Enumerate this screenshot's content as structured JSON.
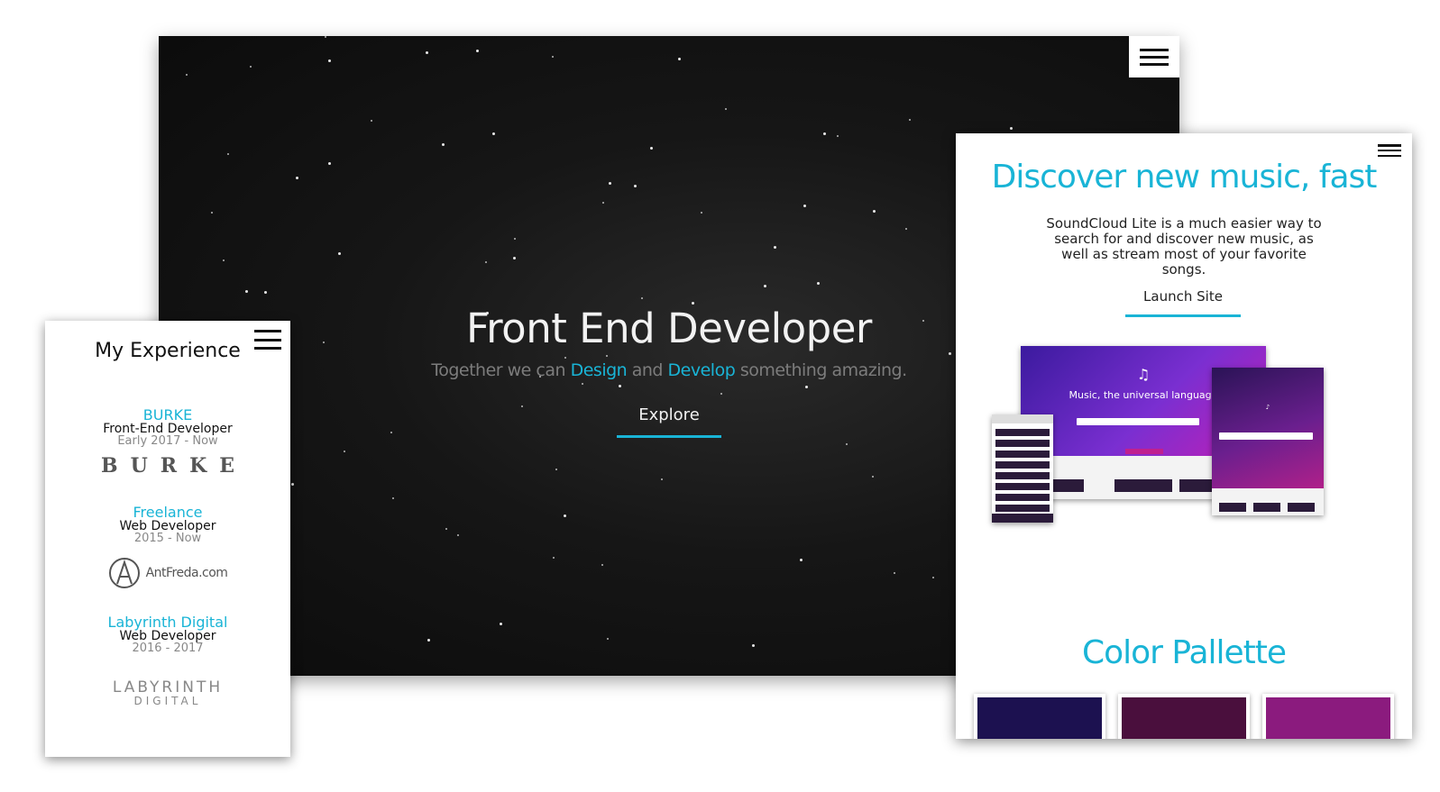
{
  "hero": {
    "title": "Front End Developer",
    "tagline_pre": "Together we can",
    "tagline_design": "Design",
    "tagline_and": "and",
    "tagline_develop": "Develop",
    "tagline_post": "something amazing.",
    "explore": "Explore",
    "menu_icon": "hamburger-menu-icon",
    "accent": "#19b4d6"
  },
  "experience": {
    "title": "My Experience",
    "menu_icon": "hamburger-menu-icon",
    "jobs": [
      {
        "company": "BURKE",
        "role": "Front-End Developer",
        "dates": "Early 2017 - Now",
        "logo": "BURKE"
      },
      {
        "company": "Freelance",
        "role": "Web Developer",
        "dates": "2015 - Now",
        "logo": "AntFreda.com"
      },
      {
        "company": "Labyrinth Digital",
        "role": "Web Developer",
        "dates": "2016 - 2017",
        "logo": "LABYRINTH",
        "logo_sub": "DIGITAL"
      }
    ]
  },
  "soundcloud": {
    "title": "Discover new music, fast",
    "description": "SoundCloud Lite is a much easier way to search for and discover new music, as well as stream most of your favorite songs.",
    "launch": "Launch Site",
    "palette_title": "Color Pallette",
    "menu_icon": "hamburger-menu-icon",
    "device_tagline": "Music, the universal language",
    "swatches": [
      "#1c1150",
      "#4a0f3d",
      "#8b1b7e"
    ]
  }
}
